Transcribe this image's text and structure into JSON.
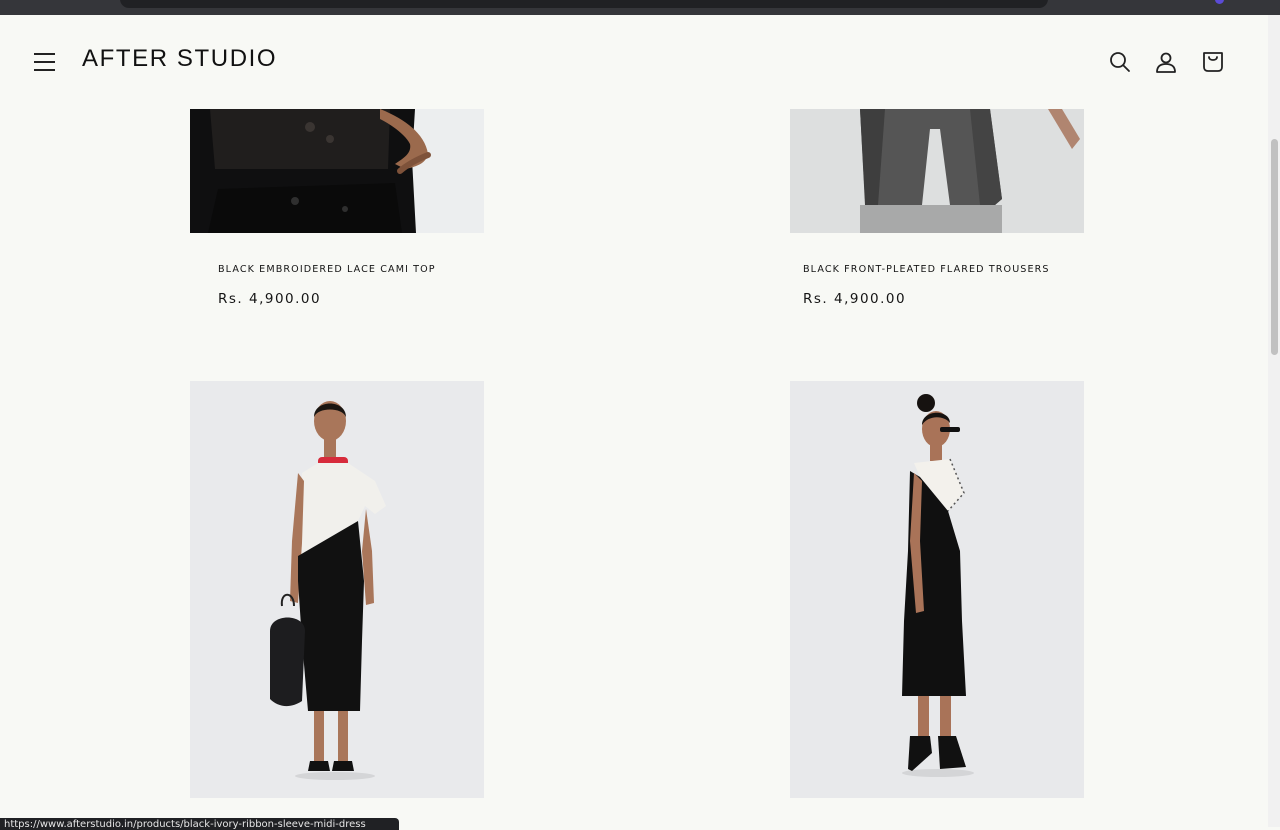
{
  "browser": {
    "status_url": "https://www.afterstudio.in/products/black-ivory-ribbon-sleeve-midi-dress"
  },
  "header": {
    "logo": "AFTER STUDIO",
    "icons": [
      "menu-icon",
      "search-icon",
      "account-icon",
      "cart-icon"
    ]
  },
  "products": [
    {
      "title": "BLACK EMBROIDERED LACE CAMI TOP",
      "price": "Rs. 4,900.00"
    },
    {
      "title": "BLACK FRONT-PLEATED FLARED TROUSERS",
      "price": "Rs. 4,900.00"
    },
    {
      "title": "",
      "price": ""
    },
    {
      "title": "",
      "price": ""
    }
  ],
  "colors": {
    "background": "#f8f9f5",
    "text": "#111111",
    "photo_backdrop": "#e8e9eb",
    "accent_red": "#d72b3b"
  }
}
